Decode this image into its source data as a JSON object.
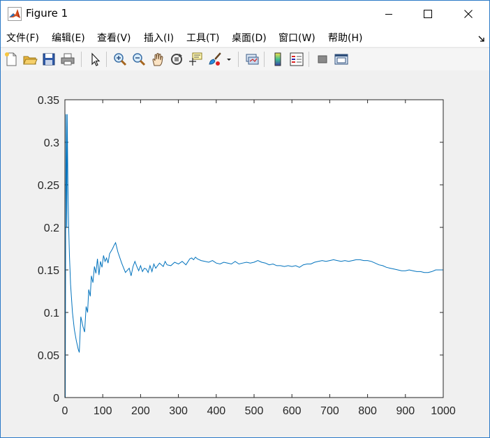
{
  "window": {
    "title": "Figure 1",
    "accent_color": "#2b79c7"
  },
  "menu": {
    "items": [
      "文件(F)",
      "编辑(E)",
      "查看(V)",
      "插入(I)",
      "工具(T)",
      "桌面(D)",
      "窗口(W)",
      "帮助(H)"
    ]
  },
  "toolbar": {
    "icons": [
      "new-figure-icon",
      "open-file-icon",
      "save-icon",
      "print-icon",
      "edit-plot-arrow-icon",
      "zoom-in-icon",
      "zoom-out-icon",
      "pan-hand-icon",
      "rotate-3d-icon",
      "data-cursor-icon",
      "brush-icon",
      "brush-dropdown-icon",
      "link-plot-icon",
      "colorbar-icon",
      "legend-icon",
      "hide-plot-tools-icon",
      "show-plot-tools-icon"
    ]
  },
  "chart_data": {
    "type": "line",
    "title": "",
    "xlabel": "",
    "ylabel": "",
    "xlim": [
      0,
      1000
    ],
    "ylim": [
      0,
      0.35
    ],
    "xticks": [
      "0",
      "100",
      "200",
      "300",
      "400",
      "500",
      "600",
      "700",
      "800",
      "900",
      "1000"
    ],
    "yticks": [
      "0",
      "0.05",
      "0.1",
      "0.15",
      "0.2",
      "0.25",
      "0.3",
      "0.35"
    ],
    "line_color": "#0072bd",
    "series": [
      {
        "x": [
          1,
          2,
          3,
          4,
          5,
          6,
          8,
          10,
          12,
          15,
          20,
          25,
          30,
          35,
          38,
          42,
          48,
          52,
          56,
          60,
          63,
          67,
          70,
          74,
          78,
          82,
          86,
          90,
          94,
          98,
          102,
          106,
          110,
          114,
          118,
          122,
          126,
          130,
          134,
          140,
          150,
          160,
          170,
          175,
          180,
          185,
          190,
          195,
          200,
          205,
          210,
          215,
          220,
          225,
          230,
          235,
          240,
          250,
          260,
          265,
          270,
          280,
          290,
          300,
          310,
          320,
          330,
          335,
          340,
          345,
          350,
          360,
          370,
          380,
          390,
          400,
          410,
          420,
          430,
          440,
          450,
          460,
          470,
          480,
          490,
          500,
          510,
          520,
          530,
          540,
          550,
          560,
          570,
          580,
          590,
          600,
          610,
          620,
          630,
          640,
          650,
          660,
          670,
          680,
          690,
          700,
          710,
          720,
          730,
          740,
          750,
          760,
          770,
          780,
          790,
          800,
          810,
          820,
          830,
          840,
          850,
          860,
          870,
          880,
          890,
          900,
          910,
          920,
          930,
          940,
          950,
          960,
          970,
          980,
          990,
          1000
        ],
        "y": [
          0.0,
          0.2,
          0.333,
          0.25,
          0.2,
          0.333,
          0.25,
          0.2,
          0.167,
          0.133,
          0.1,
          0.08,
          0.067,
          0.057,
          0.053,
          0.095,
          0.083,
          0.077,
          0.107,
          0.1,
          0.127,
          0.119,
          0.143,
          0.135,
          0.154,
          0.146,
          0.163,
          0.144,
          0.16,
          0.153,
          0.167,
          0.16,
          0.164,
          0.158,
          0.169,
          0.172,
          0.175,
          0.179,
          0.182,
          0.171,
          0.158,
          0.147,
          0.152,
          0.143,
          0.154,
          0.16,
          0.154,
          0.149,
          0.155,
          0.148,
          0.152,
          0.151,
          0.147,
          0.155,
          0.148,
          0.157,
          0.152,
          0.158,
          0.154,
          0.16,
          0.156,
          0.155,
          0.159,
          0.157,
          0.16,
          0.156,
          0.163,
          0.164,
          0.162,
          0.165,
          0.163,
          0.161,
          0.16,
          0.159,
          0.161,
          0.158,
          0.157,
          0.159,
          0.158,
          0.157,
          0.16,
          0.157,
          0.158,
          0.159,
          0.158,
          0.159,
          0.161,
          0.159,
          0.158,
          0.156,
          0.157,
          0.155,
          0.155,
          0.154,
          0.155,
          0.154,
          0.155,
          0.153,
          0.156,
          0.157,
          0.157,
          0.159,
          0.16,
          0.161,
          0.16,
          0.161,
          0.162,
          0.161,
          0.16,
          0.161,
          0.16,
          0.161,
          0.162,
          0.162,
          0.161,
          0.161,
          0.16,
          0.158,
          0.156,
          0.155,
          0.153,
          0.152,
          0.151,
          0.15,
          0.149,
          0.149,
          0.15,
          0.149,
          0.148,
          0.148,
          0.147,
          0.147,
          0.148,
          0.15,
          0.15,
          0.15
        ]
      }
    ]
  }
}
